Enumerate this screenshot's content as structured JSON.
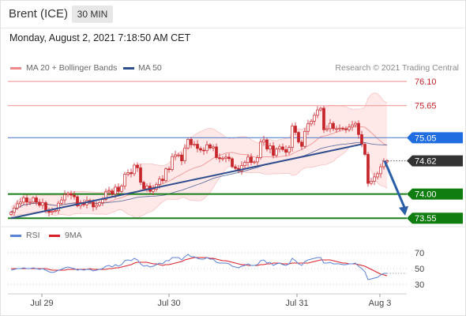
{
  "header": {
    "symbol": "Brent (ICE)",
    "timeframe": "30 MIN"
  },
  "timestamp": "Monday, August 2, 2021 7:18:50 AM CET",
  "legend": {
    "bollinger": "MA 20 + Bollinger Bands",
    "ma50": "MA 50",
    "credit": "Research © 2021 Trading Central"
  },
  "rsi_legend": {
    "rsi": "RSI",
    "ma": "9MA"
  },
  "colors": {
    "candle": "#c6252b",
    "bollinger": "#f08a8a",
    "ma50": "#2e4d8c",
    "resistance": "#f3a0a0",
    "pivot": "#6d8fd0",
    "support": "#1a7f1a",
    "current": "#333333",
    "arrow": "#2a5fa8",
    "rsi": "#5b82d6",
    "rsi_ma": "#d8202a"
  },
  "chart_data": {
    "type": "candlestick",
    "price_axis": {
      "ylim": [
        73.45,
        76.22
      ]
    },
    "x_ticks": [
      "Jul 29",
      "Jul 30",
      "Jul 31",
      "Aug 3"
    ],
    "levels": [
      {
        "value": 76.1,
        "label": "76.10",
        "kind": "resistance"
      },
      {
        "value": 75.65,
        "label": "75.65",
        "kind": "resistance"
      },
      {
        "value": 75.05,
        "label": "75.05",
        "kind": "pivot"
      },
      {
        "value": 74.62,
        "label": "74.62",
        "kind": "current"
      },
      {
        "value": 74.0,
        "label": "74.00",
        "kind": "support"
      },
      {
        "value": 73.55,
        "label": "73.55",
        "kind": "support"
      }
    ],
    "trendline": {
      "from": [
        0,
        73.55
      ],
      "to": [
        111,
        74.93
      ]
    },
    "forecast_arrow": {
      "from": [
        118,
        74.62
      ],
      "to": [
        125,
        73.6
      ]
    },
    "close": [
      73.66,
      73.74,
      73.82,
      73.85,
      73.93,
      73.85,
      73.85,
      73.93,
      73.85,
      73.79,
      73.84,
      73.69,
      73.66,
      73.68,
      73.69,
      73.83,
      73.89,
      73.99,
      74.01,
      73.98,
      73.95,
      73.78,
      73.84,
      73.8,
      73.88,
      73.85,
      73.76,
      73.79,
      73.84,
      73.9,
      74.04,
      74.06,
      74.0,
      74.13,
      74.05,
      74.15,
      74.37,
      74.4,
      74.38,
      74.54,
      74.49,
      74.22,
      74.1,
      74.15,
      74.05,
      74.09,
      74.18,
      74.28,
      74.25,
      74.47,
      74.46,
      74.7,
      74.73,
      74.73,
      74.62,
      74.86,
      75.02,
      74.92,
      74.93,
      74.85,
      74.82,
      74.81,
      74.92,
      74.86,
      74.88,
      74.68,
      74.66,
      74.67,
      74.69,
      74.66,
      74.51,
      74.48,
      74.43,
      74.53,
      74.59,
      74.69,
      74.59,
      74.6,
      74.68,
      74.97,
      75.01,
      74.84,
      74.9,
      74.72,
      74.84,
      74.88,
      74.83,
      74.78,
      74.87,
      75.27,
      75.15,
      74.97,
      74.89,
      75.17,
      75.31,
      75.36,
      75.47,
      75.57,
      75.6,
      75.2,
      75.22,
      75.32,
      75.22,
      75.22,
      75.23,
      75.22,
      75.2,
      75.25,
      75.29,
      75.32,
      75.11,
      74.93,
      74.74,
      74.2,
      74.24,
      74.32,
      74.38,
      74.51,
      74.6,
      74.62
    ],
    "rsi_axis": {
      "ylim": [
        20,
        80
      ],
      "ticks": [
        30,
        50,
        70
      ]
    },
    "rsi": [
      48,
      49,
      50,
      50,
      51,
      50,
      50,
      51,
      50,
      49,
      50,
      48,
      46,
      45,
      46,
      48,
      49,
      51,
      52,
      51,
      50,
      48,
      49,
      48,
      49,
      49,
      47,
      48,
      49,
      50,
      53,
      54,
      52,
      55,
      53,
      55,
      60,
      61,
      60,
      63,
      61,
      56,
      53,
      54,
      52,
      53,
      55,
      57,
      56,
      60,
      60,
      64,
      64,
      64,
      61,
      65,
      68,
      65,
      65,
      63,
      62,
      62,
      64,
      62,
      62,
      58,
      57,
      57,
      57,
      56,
      53,
      52,
      51,
      53,
      54,
      56,
      54,
      54,
      55,
      60,
      61,
      57,
      58,
      54,
      56,
      57,
      55,
      54,
      56,
      63,
      60,
      56,
      54,
      59,
      61,
      62,
      63,
      64,
      64,
      57,
      57,
      58,
      56,
      56,
      56,
      55,
      55,
      56,
      56,
      57,
      53,
      50,
      46,
      36,
      37,
      38,
      39,
      42,
      44,
      44
    ],
    "rsi_ma": [
      50,
      50,
      50,
      50,
      50,
      50,
      50,
      50,
      50,
      50,
      50,
      50,
      49,
      48,
      48,
      48,
      48,
      48,
      49,
      49,
      49,
      49,
      49,
      49,
      49,
      50,
      49,
      49,
      49,
      49,
      49,
      50,
      50,
      51,
      51,
      52,
      53,
      54,
      55,
      57,
      58,
      58,
      58,
      58,
      57,
      56,
      56,
      55,
      54,
      55,
      55,
      56,
      57,
      58,
      59,
      61,
      62,
      63,
      64,
      64,
      64,
      64,
      64,
      63,
      63,
      62,
      61,
      60,
      60,
      59,
      58,
      57,
      56,
      55,
      55,
      54,
      54,
      54,
      54,
      55,
      55,
      56,
      56,
      57,
      57,
      57,
      56,
      56,
      56,
      57,
      57,
      57,
      57,
      57,
      57,
      58,
      59,
      60,
      61,
      61,
      61,
      61,
      60,
      59,
      58,
      57,
      57,
      56,
      56,
      56,
      55,
      54,
      53,
      51,
      49,
      47,
      45,
      43,
      42,
      41
    ]
  }
}
